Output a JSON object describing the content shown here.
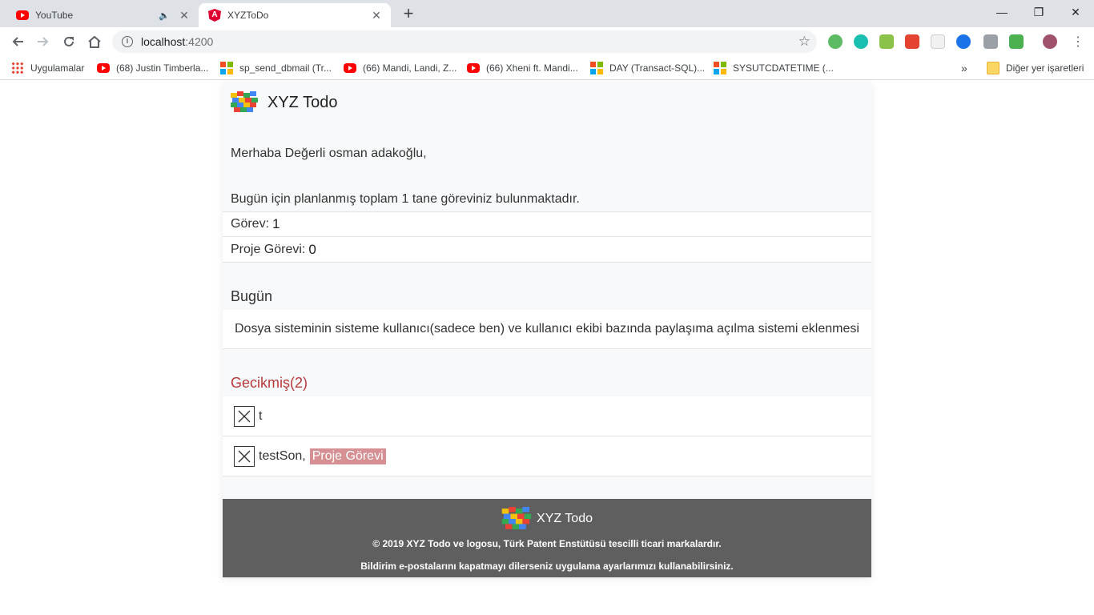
{
  "browser": {
    "tabs": [
      {
        "title": "YouTube",
        "active": false,
        "icon": "youtube-icon"
      },
      {
        "title": "XYZToDo",
        "active": true,
        "icon": "angular-icon"
      }
    ],
    "address": {
      "host": "localhost",
      "port": ":4200"
    },
    "bookmarks": [
      {
        "label": "Uygulamalar",
        "icon": "apps-icon"
      },
      {
        "label": "(68) Justin Timberla...",
        "icon": "youtube-icon"
      },
      {
        "label": "sp_send_dbmail (Tr...",
        "icon": "microsoft-icon"
      },
      {
        "label": "(66) Mandi, Landi, Z...",
        "icon": "youtube-icon"
      },
      {
        "label": "(66) Xheni ft. Mandi...",
        "icon": "youtube-icon"
      },
      {
        "label": "DAY (Transact-SQL)...",
        "icon": "microsoft-icon"
      },
      {
        "label": "SYSUTCDATETIME (...",
        "icon": "microsoft-icon"
      }
    ],
    "other_bookmarks": "Diğer yer işaretleri",
    "overflow": "»"
  },
  "app": {
    "brand": "XYZ Todo",
    "greeting": "Merhaba Değerli osman adakoğlu,",
    "summary_prefix": "Bugün için planlanmış toplam",
    "summary_count": "1",
    "summary_suffix": "tane göreviniz bulunmaktadır.",
    "stats": [
      {
        "label": "Görev:",
        "value": "1"
      },
      {
        "label": "Proje Görevi:",
        "value": "0"
      }
    ],
    "today": {
      "title": "Bugün",
      "tasks": [
        "Dosya sisteminin sisteme kullanıcı(sadece ben) ve kullanıcı ekibi bazında paylaşıma açılma sistemi eklenmesi"
      ]
    },
    "late": {
      "title": "Gecikmiş(2)",
      "tasks": [
        {
          "name": "t",
          "badge": ""
        },
        {
          "name": "testSon,",
          "badge": "Proje Görevi"
        }
      ]
    },
    "footer": {
      "brand": "XYZ Todo",
      "copyright": "© 2019 XYZ Todo ve logosu, Türk Patent Enstütüsü tescilli ticari markalardır.",
      "notice": "Bildirim e-postalarını kapatmayı dilerseniz uygulama ayarlarımızı kullanabilirsiniz."
    },
    "colors": {
      "late": "#b8393a",
      "badge": "#d68f93",
      "footer": "#5f5f5f"
    }
  }
}
